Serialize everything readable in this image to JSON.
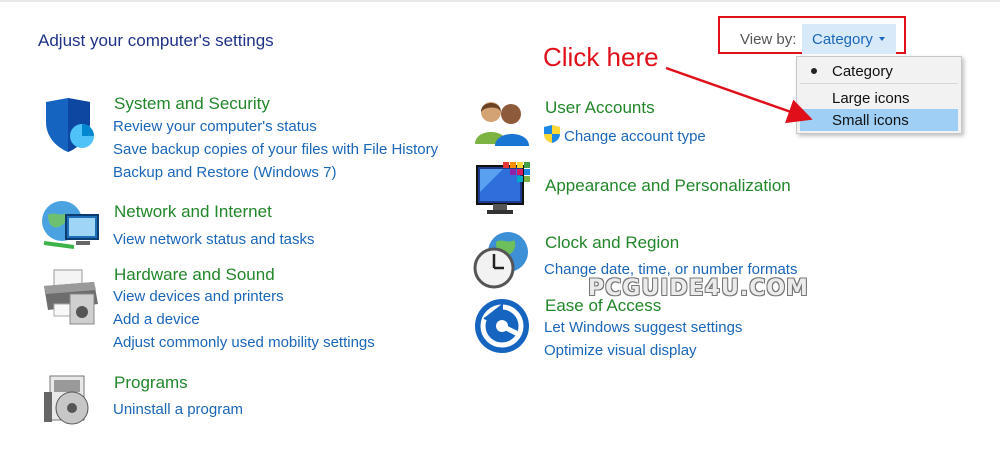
{
  "page": {
    "title": "Adjust your computer's settings"
  },
  "view_by": {
    "label": "View by:",
    "selected": "Category",
    "options": [
      "Category",
      "Large icons",
      "Small icons"
    ],
    "highlighted": "Small icons"
  },
  "annotation": {
    "text": "Click here",
    "color": "#e0101a"
  },
  "watermark": "PCGUIDE4U.COM",
  "categories": {
    "system_security": {
      "icon": "shield-icon",
      "title": "System and Security",
      "links": [
        "Review your computer's status",
        "Save backup copies of your files with File History",
        "Backup and Restore (Windows 7)"
      ]
    },
    "network_internet": {
      "icon": "network-globe-icon",
      "title": "Network and Internet",
      "links": [
        "View network status and tasks"
      ]
    },
    "hardware_sound": {
      "icon": "printer-icon",
      "title": "Hardware and Sound",
      "links": [
        "View devices and printers",
        "Add a device",
        "Adjust commonly used mobility settings"
      ]
    },
    "programs": {
      "icon": "programs-disc-icon",
      "title": "Programs",
      "links": [
        "Uninstall a program"
      ]
    },
    "user_accounts": {
      "icon": "users-icon",
      "title": "User Accounts",
      "links": [
        "Change account type"
      ]
    },
    "appearance": {
      "icon": "monitor-palette-icon",
      "title": "Appearance and Personalization",
      "links": []
    },
    "clock_region": {
      "icon": "clock-globe-icon",
      "title": "Clock and Region",
      "links": [
        "Change date, time, or number formats"
      ]
    },
    "ease_access": {
      "icon": "ease-of-access-icon",
      "title": "Ease of Access",
      "links": [
        "Let Windows suggest settings",
        "Optimize visual display"
      ]
    }
  },
  "colors": {
    "title_blue": "#1e3287",
    "category_green": "#22862a",
    "link_blue": "#1a66b8",
    "menu_highlight": "#9fcff5",
    "annotation_red": "#e0101a"
  }
}
